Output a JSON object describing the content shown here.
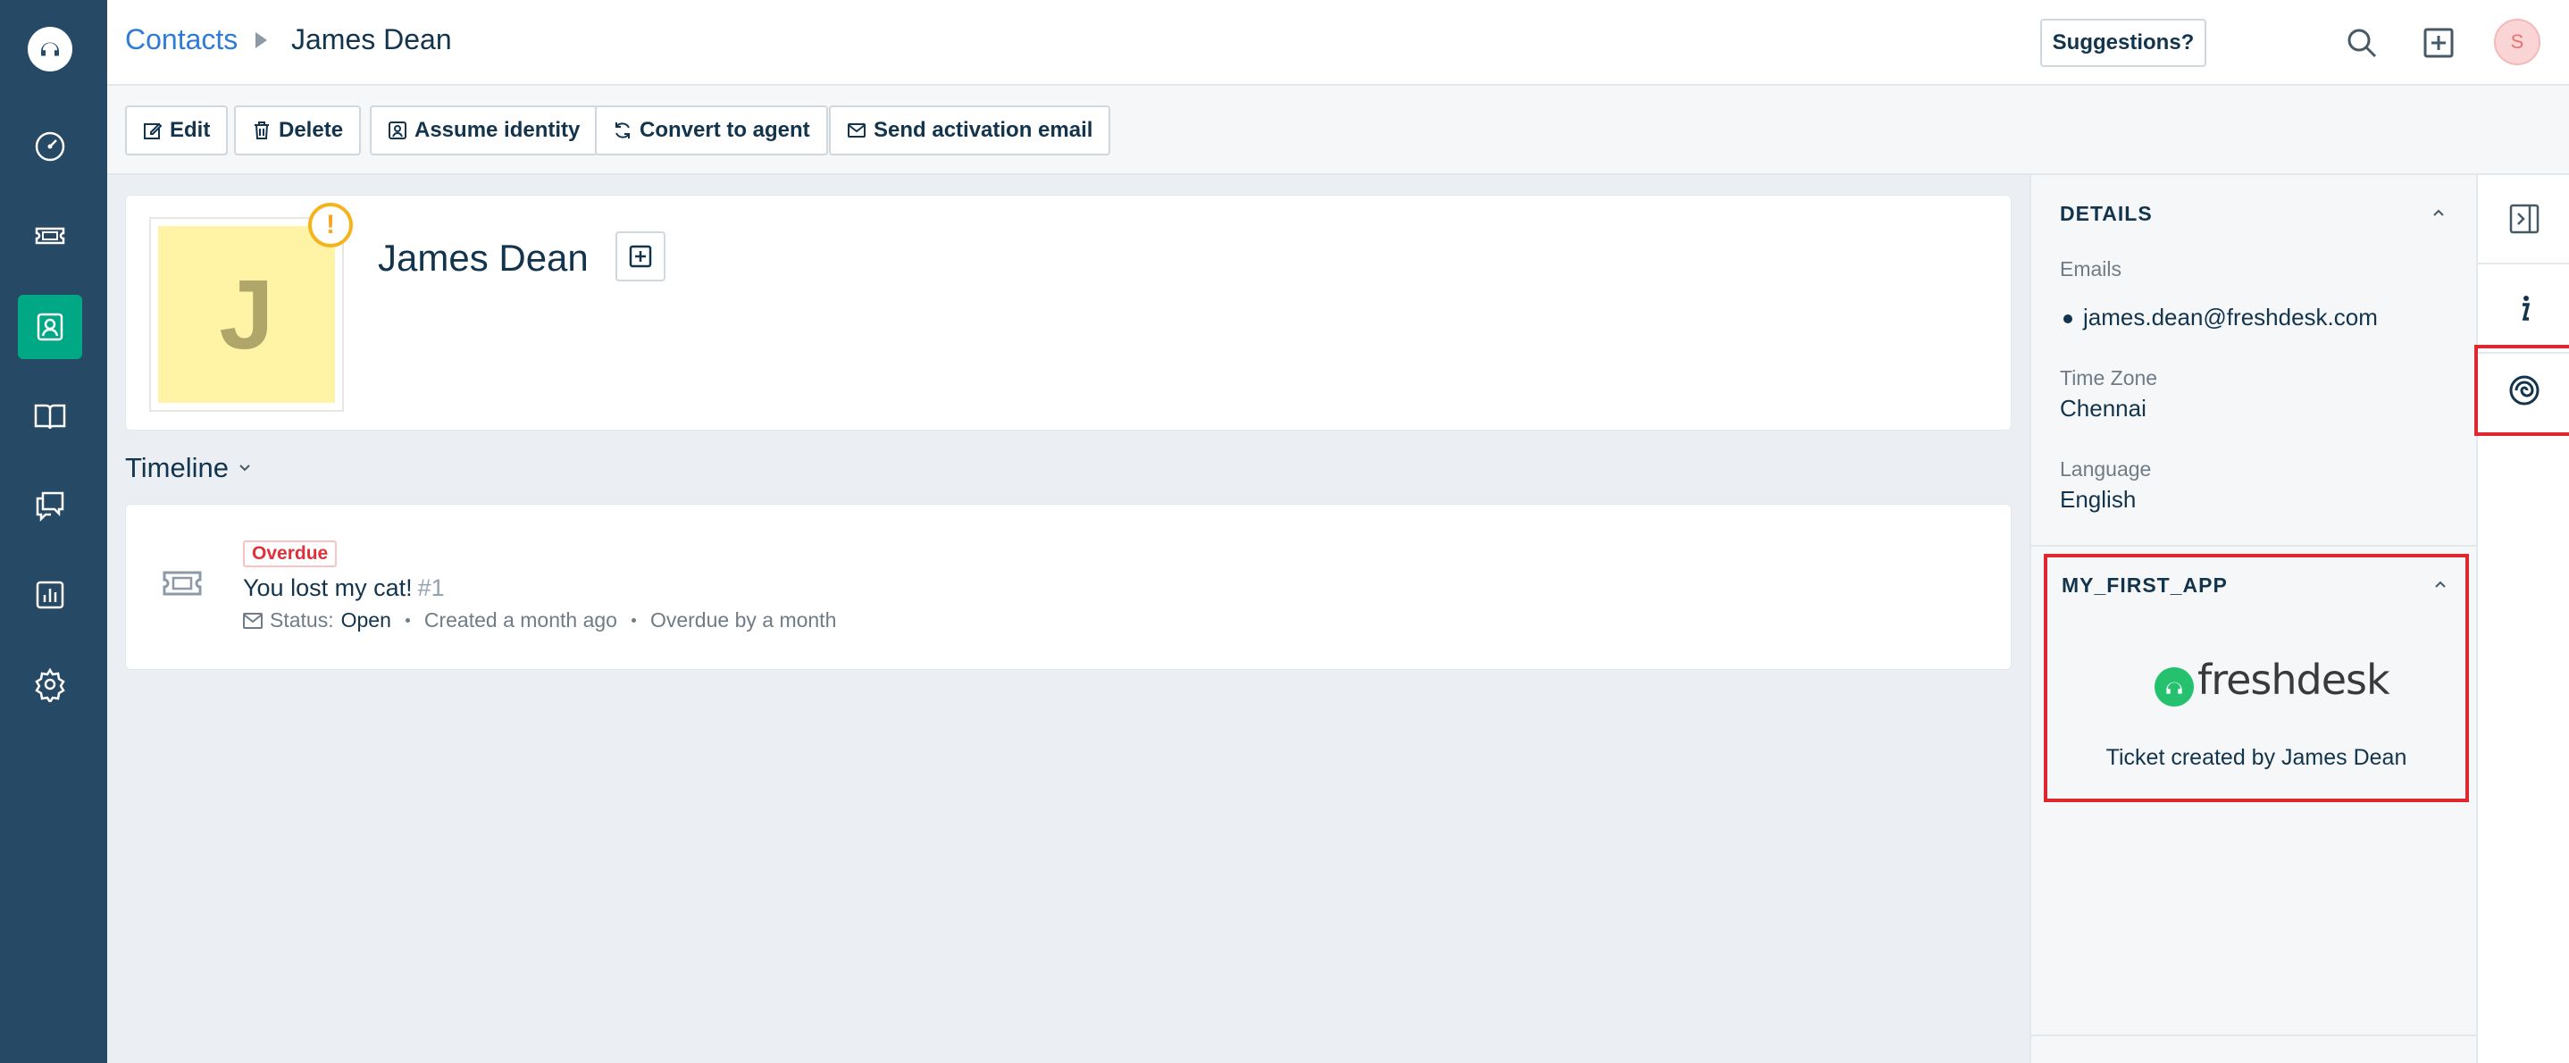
{
  "nav": {
    "items": [
      {
        "name": "dashboard-icon"
      },
      {
        "name": "tickets-icon"
      },
      {
        "name": "contacts-icon",
        "active": true
      },
      {
        "name": "solutions-icon"
      },
      {
        "name": "forums-icon"
      },
      {
        "name": "reports-icon"
      },
      {
        "name": "admin-gear-icon"
      }
    ]
  },
  "header": {
    "breadcrumb_link": "Contacts",
    "breadcrumb_current": "James Dean",
    "suggestions_label": "Suggestions?",
    "avatar_initial": "S"
  },
  "toolbar": {
    "edit_label": "Edit",
    "delete_label": "Delete",
    "assume_label": "Assume identity",
    "convert_label": "Convert to agent",
    "activation_label": "Send activation email"
  },
  "profile": {
    "initial": "J",
    "name": "James Dean",
    "warning": "!"
  },
  "timeline": {
    "title": "Timeline",
    "items": [
      {
        "badge": "Overdue",
        "subject": "You lost my cat!",
        "number": "#1",
        "status_label": "Status:",
        "status_value": "Open",
        "created": "Created a month ago",
        "overdue": "Overdue by a month"
      }
    ]
  },
  "details": {
    "title": "DETAILS",
    "emails_label": "Emails",
    "email": "james.dean@freshdesk.com",
    "timezone_label": "Time Zone",
    "timezone": "Chennai",
    "language_label": "Language",
    "language": "English"
  },
  "app": {
    "title": "MY_FIRST_APP",
    "logo_text": "freshdesk",
    "message": "Ticket created by James Dean"
  },
  "colors": {
    "nav_bg": "#264966",
    "nav_active": "#00a886",
    "link": "#2f7cd6",
    "highlight": "#e0262f",
    "overdue": "#e0303a"
  }
}
